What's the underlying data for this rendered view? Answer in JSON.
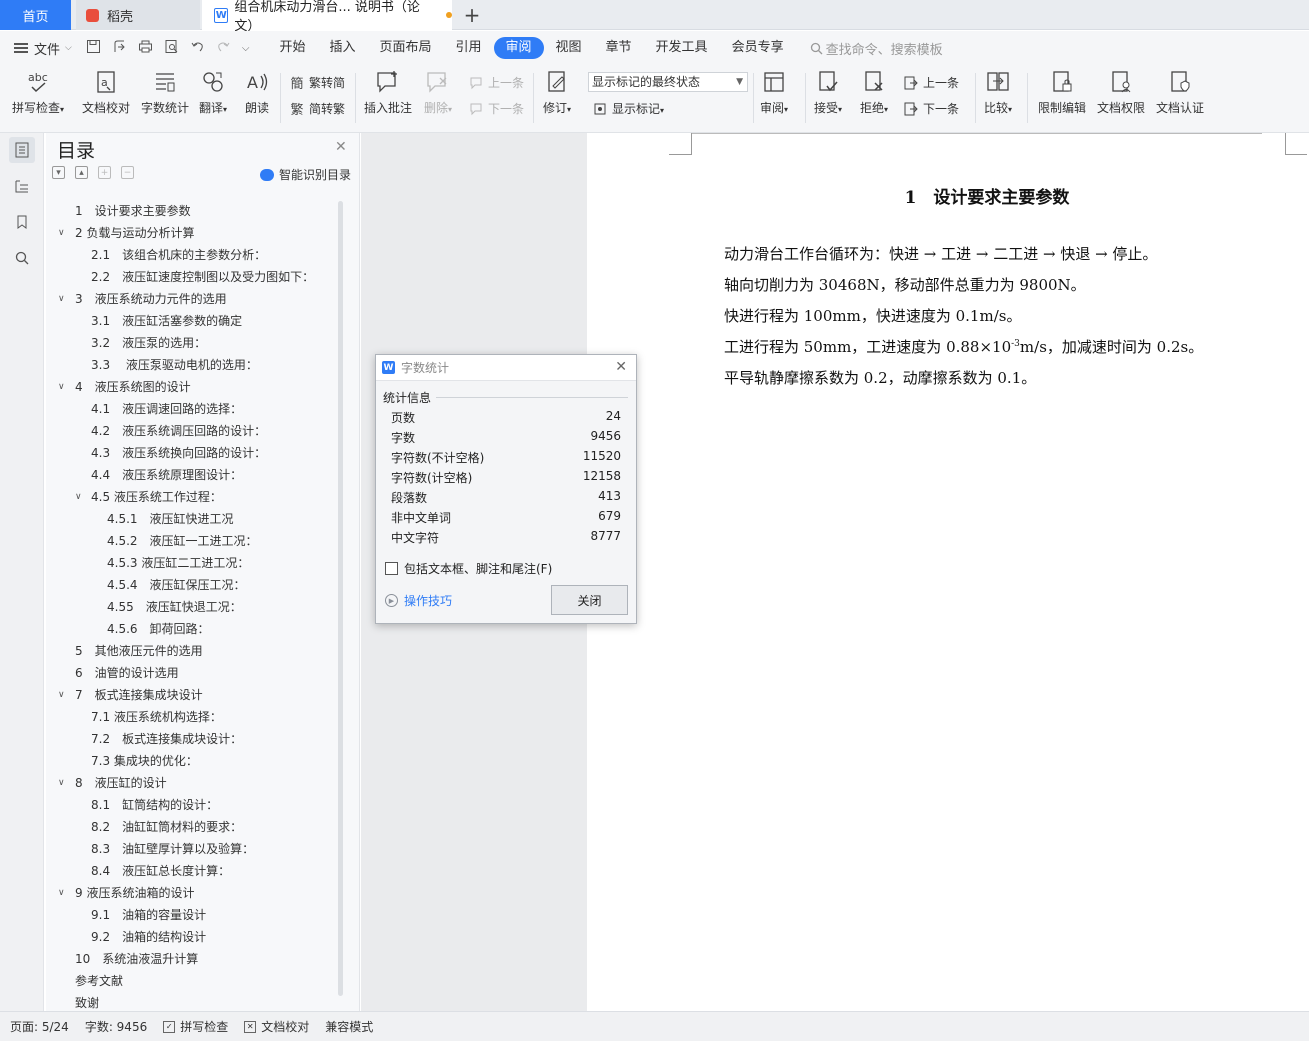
{
  "tabs": {
    "home": "首页",
    "docer": "稻壳",
    "document": "组合机床动力滑台... 说明书（论文）",
    "add": "+"
  },
  "menu": {
    "file": "文件",
    "tabs": [
      "开始",
      "插入",
      "页面布局",
      "引用",
      "审阅",
      "视图",
      "章节",
      "开发工具",
      "会员专享"
    ],
    "active_tab": "审阅",
    "search_placeholder": "查找命令、搜索模板"
  },
  "ribbon": {
    "spell_check": "拼写检查",
    "doc_proof": "文档校对",
    "word_count": "字数统计",
    "translate": "翻译",
    "read_aloud": "朗读",
    "trad_to_simp": "繁转简",
    "simp_to_trad": "简转繁",
    "insert_comment": "插入批注",
    "delete": "删除",
    "prev_comment": "上一条",
    "next_comment": "下一条",
    "track_changes": "修订",
    "markup_select": "显示标记的最终状态",
    "show_markup": "显示标记",
    "review": "审阅",
    "accept": "接受",
    "reject": "拒绝",
    "prev_change": "上一条",
    "next_change": "下一条",
    "compare": "比较",
    "restrict_edit": "限制编辑",
    "doc_permission": "文档权限",
    "doc_certify": "文档认证",
    "abc_glyph": "abc"
  },
  "toc": {
    "title": "目录",
    "smart_label": "智能识别目录",
    "items": [
      {
        "text": "1　设计要求主要参数",
        "indent": 0,
        "chev": false
      },
      {
        "text": "2 负载与运动分析计算",
        "indent": 0,
        "chev": true
      },
      {
        "text": "2.1　该组合机床的主参数分析：",
        "indent": 1,
        "chev": false
      },
      {
        "text": "2.2　液压缸速度控制图以及受力图如下：",
        "indent": 1,
        "chev": false
      },
      {
        "text": "3　液压系统动力元件的选用",
        "indent": 0,
        "chev": true
      },
      {
        "text": "3.1　液压缸活塞参数的确定",
        "indent": 1,
        "chev": false
      },
      {
        "text": "3.2　液压泵的选用：",
        "indent": 1,
        "chev": false
      },
      {
        "text": "3.3　 液压泵驱动电机的选用：",
        "indent": 1,
        "chev": false
      },
      {
        "text": "4　液压系统图的设计",
        "indent": 0,
        "chev": true
      },
      {
        "text": "4.1　液压调速回路的选择：",
        "indent": 1,
        "chev": false
      },
      {
        "text": "4.2　液压系统调压回路的设计：",
        "indent": 1,
        "chev": false
      },
      {
        "text": "4.3　液压系统换向回路的设计：",
        "indent": 1,
        "chev": false
      },
      {
        "text": "4.4　液压系统原理图设计：",
        "indent": 1,
        "chev": false
      },
      {
        "text": "4.5 液压系统工作过程：",
        "indent": 1,
        "chev": true
      },
      {
        "text": "4.5.1　液压缸快进工况",
        "indent": 2,
        "chev": false
      },
      {
        "text": "4.5.2　液压缸一工进工况：",
        "indent": 2,
        "chev": false
      },
      {
        "text": "4.5.3 液压缸二工进工况：",
        "indent": 2,
        "chev": false
      },
      {
        "text": "4.5.4　液压缸保压工况：",
        "indent": 2,
        "chev": false
      },
      {
        "text": "4.55　液压缸快退工况：",
        "indent": 2,
        "chev": false
      },
      {
        "text": "4.5.6　卸荷回路：",
        "indent": 2,
        "chev": false
      },
      {
        "text": "5　其他液压元件的选用",
        "indent": 0,
        "chev": false
      },
      {
        "text": "6　油管的设计选用",
        "indent": 0,
        "chev": false
      },
      {
        "text": "7　板式连接集成块设计",
        "indent": 0,
        "chev": true
      },
      {
        "text": "7.1 液压系统机构选择：",
        "indent": 1,
        "chev": false
      },
      {
        "text": "7.2　板式连接集成块设计：",
        "indent": 1,
        "chev": false
      },
      {
        "text": "7.3 集成块的优化：",
        "indent": 1,
        "chev": false
      },
      {
        "text": "8　液压缸的设计",
        "indent": 0,
        "chev": true
      },
      {
        "text": "8.1　缸筒结构的设计：",
        "indent": 1,
        "chev": false
      },
      {
        "text": "8.2　油缸缸筒材料的要求：",
        "indent": 1,
        "chev": false
      },
      {
        "text": "8.3　油缸壁厚计算以及验算：",
        "indent": 1,
        "chev": false
      },
      {
        "text": "8.4　液压缸总长度计算：",
        "indent": 1,
        "chev": false
      },
      {
        "text": "9 液压系统油箱的设计",
        "indent": 0,
        "chev": true
      },
      {
        "text": "9.1　油箱的容量设计",
        "indent": 1,
        "chev": false
      },
      {
        "text": "9.2　油箱的结构设计",
        "indent": 1,
        "chev": false
      },
      {
        "text": "10　系统油液温升计算",
        "indent": 0,
        "chev": false
      },
      {
        "text": "参考文献",
        "indent": 0,
        "chev": false
      },
      {
        "text": "致谢",
        "indent": 0,
        "chev": false
      }
    ]
  },
  "document": {
    "heading": "1　设计要求主要参数",
    "lines": [
      "动力滑台工作台循环为：快进 → 工进 → 二工进 → 快退 → 停止。",
      "轴向切削力为 30468N，移动部件总重力为 9800N。",
      "快进行程为 100mm，快进速度为 0.1m/s。",
      "工进行程为 50mm，工进速度为 0.88×10",
      "平导轨静摩擦系数为 0.2，动摩擦系数为 0.1。"
    ],
    "line4_sup": "-3",
    "line4_rest": "m/s，加减速时间为 0.2s。"
  },
  "dialog": {
    "title": "字数统计",
    "section": "统计信息",
    "stats": [
      {
        "label": "页数",
        "value": "24"
      },
      {
        "label": "字数",
        "value": "9456"
      },
      {
        "label": "字符数(不计空格)",
        "value": "11520"
      },
      {
        "label": "字符数(计空格)",
        "value": "12158"
      },
      {
        "label": "段落数",
        "value": "413"
      },
      {
        "label": "非中文单词",
        "value": "679"
      },
      {
        "label": "中文字符",
        "value": "8777"
      }
    ],
    "checkbox_label": "包括文本框、脚注和尾注(F)",
    "tips": "操作技巧",
    "close_button": "关闭"
  },
  "statusbar": {
    "page": "页面: 5/24",
    "words": "字数: 9456",
    "spell": "拼写检查",
    "proof": "文档校对",
    "compat": "兼容模式"
  },
  "colors": {
    "accent": "#2f7cf6",
    "tab_dot": "#f0a020"
  }
}
